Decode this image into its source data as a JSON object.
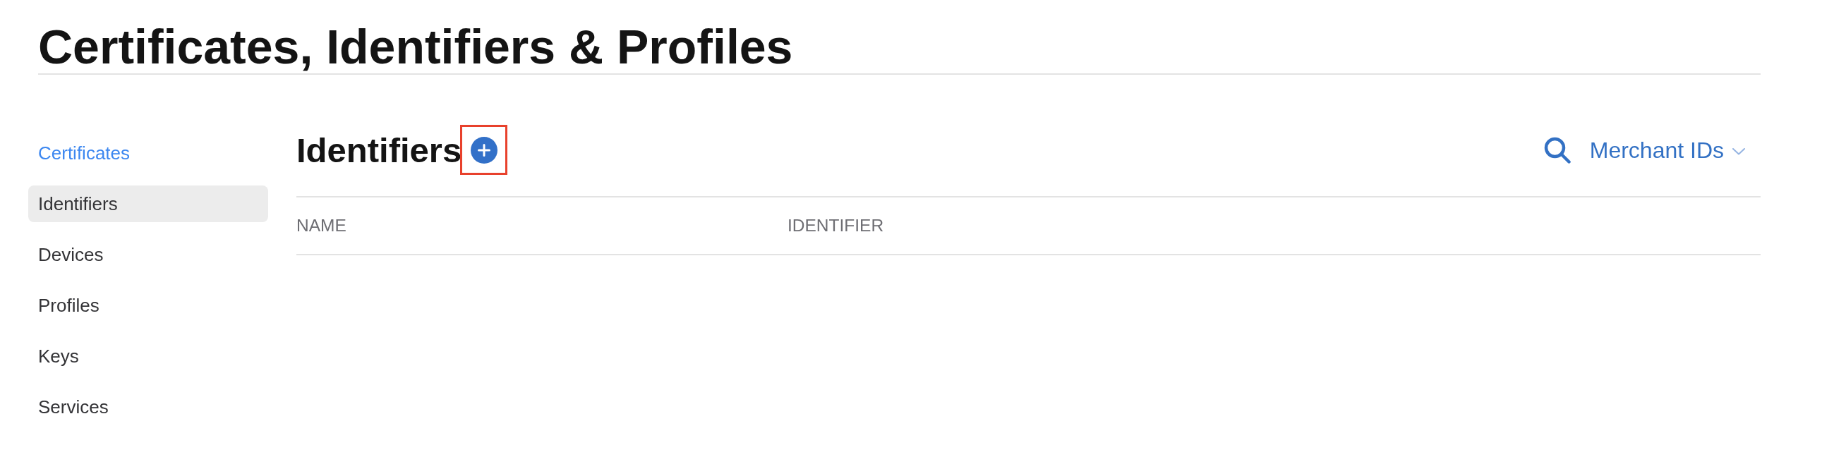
{
  "page_title": "Certificates, Identifiers & Profiles",
  "sidebar": {
    "items": [
      {
        "label": "Certificates",
        "selected": false,
        "hovered": true
      },
      {
        "label": "Identifiers",
        "selected": true,
        "hovered": false
      },
      {
        "label": "Devices",
        "selected": false,
        "hovered": false
      },
      {
        "label": "Profiles",
        "selected": false,
        "hovered": false
      },
      {
        "label": "Keys",
        "selected": false,
        "hovered": false
      },
      {
        "label": "Services",
        "selected": false,
        "hovered": false
      }
    ]
  },
  "section": {
    "title": "Identifiers",
    "add_button": {
      "highlighted": true
    },
    "filter": {
      "label": "Merchant IDs"
    }
  },
  "table": {
    "columns": [
      "NAME",
      "IDENTIFIER"
    ]
  }
}
